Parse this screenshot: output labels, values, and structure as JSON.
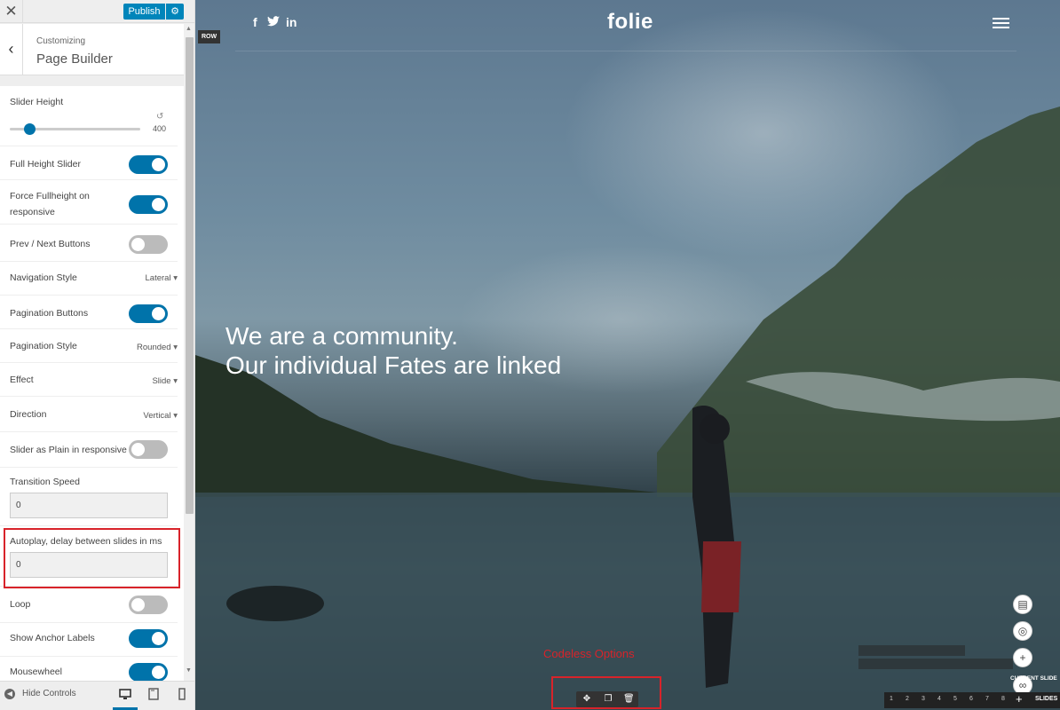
{
  "topbar": {
    "close_icon": "close-icon",
    "publish_label": "Publish",
    "publish_settings_icon": "gear-icon"
  },
  "section": {
    "crumb": "Customizing",
    "title": "Page Builder"
  },
  "controls": {
    "slider_height": {
      "label": "Slider Height",
      "value": "400",
      "reset_icon": "undo-icon",
      "slider_fraction": 0.15
    },
    "full_height": {
      "label": "Full Height Slider",
      "on": true
    },
    "force_fullheight": {
      "label_line1": "Force Fullheight on",
      "label_line2": "responsive",
      "on": true
    },
    "prev_next": {
      "label": "Prev / Next Buttons",
      "on": false
    },
    "navigation_style": {
      "label": "Navigation Style",
      "value": "Lateral"
    },
    "pagination_buttons": {
      "label": "Pagination Buttons",
      "on": true
    },
    "pagination_style": {
      "label": "Pagination Style",
      "value": "Rounded"
    },
    "effect": {
      "label": "Effect",
      "value": "Slide"
    },
    "direction": {
      "label": "Direction",
      "value": "Vertical"
    },
    "slider_plain": {
      "label": "Slider as Plain in responsive",
      "on": false
    },
    "transition_speed": {
      "label": "Transition Speed",
      "value": "0"
    },
    "autoplay": {
      "label": "Autoplay, delay between slides in ms",
      "value": "0"
    },
    "loop": {
      "label": "Loop",
      "on": false
    },
    "anchor_labels": {
      "label": "Show Anchor Labels",
      "on": true
    },
    "mousewheel": {
      "label": "Mousewheel",
      "on": true
    }
  },
  "footer": {
    "hide_label": "Hide Controls",
    "devices": [
      "desktop-icon",
      "tablet-icon",
      "mobile-icon"
    ]
  },
  "preview": {
    "social_icons": [
      "f",
      "twitter-icon",
      "in"
    ],
    "logo": "folie",
    "row_badge": "ROW",
    "headline_line1": "We are a community.",
    "headline_line2": "Our individual Fates are linked",
    "codeless_label": "Codeless Options",
    "toolbar_icons": [
      "move-icon",
      "duplicate-icon",
      "trash-icon"
    ],
    "side_buttons": [
      "page-icon",
      "globe-icon",
      "plus-icon",
      "link-icon"
    ],
    "current_slide_label": "CURRENT SLIDE",
    "slide_numbers": [
      "1",
      "2",
      "3",
      "4",
      "5",
      "6",
      "7",
      "8"
    ],
    "slides_add": "+",
    "slides_label": "SLIDES"
  },
  "colors": {
    "accent": "#0073aa",
    "publish": "#0085ba",
    "highlight": "#d8232a"
  }
}
